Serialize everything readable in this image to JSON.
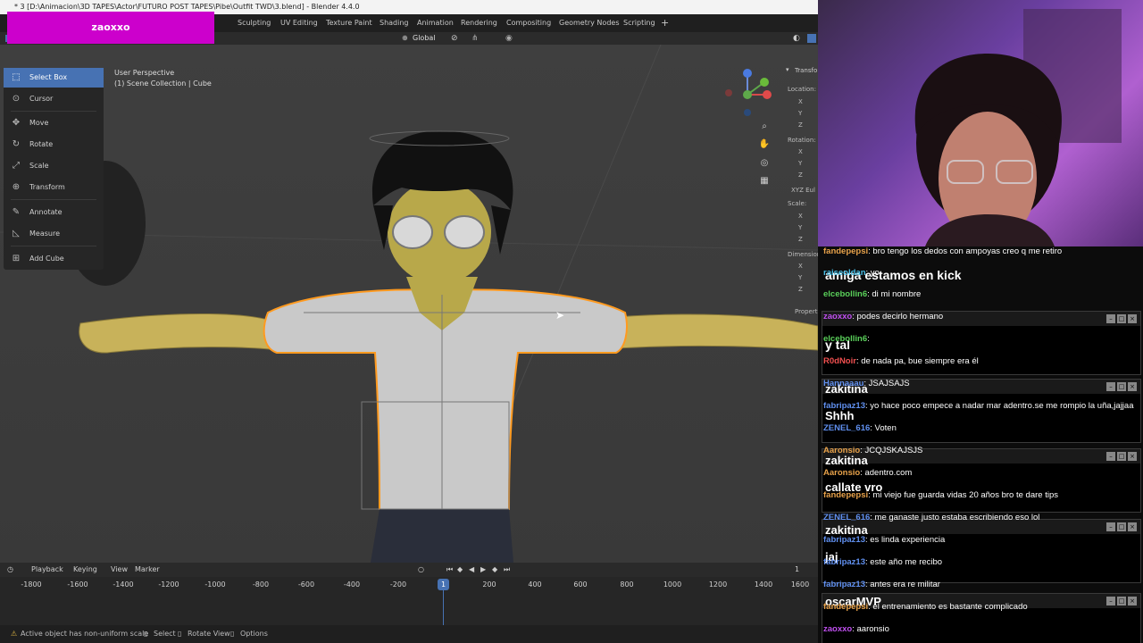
{
  "window_title": "* 3 [D:\\Animacion\\3D TAPES\\Actor\\FUTURO POST TAPES\\Pibe\\Outfit TWD\\3.blend] - Blender 4.4.0",
  "workspace_tabs": [
    "Sculpting",
    "UV Editing",
    "Texture Paint",
    "Shading",
    "Animation",
    "Rendering",
    "Compositing",
    "Geometry Nodes",
    "Scripting"
  ],
  "add_workspace": "+",
  "header": {
    "orientation": "Global"
  },
  "overlay_name": "zaoxxo",
  "viewport": {
    "view_name": "User Perspective",
    "collection": "(1) Scene Collection | Cube"
  },
  "toolbar": {
    "tools": [
      {
        "label": "Select Box",
        "icon": "select-box-icon",
        "active": true
      },
      {
        "label": "Cursor",
        "icon": "cursor-icon"
      },
      {
        "label": "Move",
        "icon": "move-icon"
      },
      {
        "label": "Rotate",
        "icon": "rotate-icon"
      },
      {
        "label": "Scale",
        "icon": "scale-icon"
      },
      {
        "label": "Transform",
        "icon": "transform-icon"
      },
      {
        "label": "Annotate",
        "icon": "annotate-icon"
      },
      {
        "label": "Measure",
        "icon": "measure-icon"
      },
      {
        "label": "Add Cube",
        "icon": "add-cube-icon"
      }
    ]
  },
  "npanel": {
    "transform": "Transfo",
    "location": "Location:",
    "rotation": "Rotation:",
    "rotation_mode": "XYZ Eul",
    "scale": "Scale:",
    "dimensions": "Dimension",
    "properties": "Properti",
    "axes": [
      "X",
      "Y",
      "Z"
    ]
  },
  "timeline": {
    "menus": [
      "Playback",
      "Keying",
      "View",
      "Marker"
    ],
    "current_frame": "1",
    "playhead_label": "1",
    "ticks": [
      "-1800",
      "-1600",
      "-1400",
      "-1200",
      "-1000",
      "-800",
      "-600",
      "-400",
      "-200",
      "200",
      "400",
      "600",
      "800",
      "1000",
      "1200",
      "1400",
      "1600"
    ]
  },
  "statusbar": {
    "warning": "Active object has non-uniform scale",
    "select": "Select",
    "rotate_view": "Rotate View",
    "options": "Options"
  },
  "chat": {
    "messages": [
      {
        "user": "fandepepsi",
        "text": ": bro tengo los dedos con ampoyas creo q me retiro",
        "color": "#e8a24a"
      },
      {
        "user": "raiseoldan",
        "text": ": yo",
        "color": "#4ac0e8"
      },
      {
        "user": "elcebollin6",
        "text": ": di mi nombre",
        "color": "#5ad05a"
      },
      {
        "user": "zaoxxo",
        "text": ": podes decirlo hermano",
        "color": "#c050f0"
      },
      {
        "user": "elcebollin6",
        "text": ":",
        "color": "#5ad05a"
      },
      {
        "user": "R0dNoir",
        "text": ": de nada pa, bue siempre era él",
        "color": "#f05050"
      },
      {
        "user": "Hannaaau",
        "text": ": JSAJSAJS",
        "color": "#6090f0"
      },
      {
        "user": "fabripaz13",
        "text": ": yo hace poco empece a nadar mar adentro.se me rompio la uña,jajjaa",
        "color": "#6090f0"
      },
      {
        "user": "ZENEL_616",
        "text": ": Voten",
        "color": "#6090f0"
      },
      {
        "user": "Aaronsio",
        "text": ": JCQJSKAJSJS",
        "color": "#e8a24a"
      },
      {
        "user": "Aaronsio",
        "text": ": adentro.com",
        "color": "#e8a24a"
      },
      {
        "user": "fandepepsi",
        "text": ": mi viejo fue guarda vidas 20 años bro te dare tips",
        "color": "#e8a24a"
      },
      {
        "user": "ZENEL_616",
        "text": ": me ganaste justo estaba escribiendo eso lol",
        "color": "#6090f0"
      },
      {
        "user": "fabripaz13",
        "text": ": es linda experiencia",
        "color": "#6090f0"
      },
      {
        "user": "fabripaz13",
        "text": ": este año me recibo",
        "color": "#6090f0"
      },
      {
        "user": "fabripaz13",
        "text": ": antes era re militar",
        "color": "#6090f0"
      },
      {
        "user": "fandepepsi",
        "text": ": el entrenamiento es bastante complicado",
        "color": "#e8a24a"
      },
      {
        "user": "zaoxxo",
        "text": ": aaronsio",
        "color": "#c050f0"
      }
    ],
    "overlays": [
      "amiga estamos en kick",
      "y tal",
      "zakitina",
      "Shhh",
      "zakitina",
      "callate vro",
      "zakitina",
      "jaj",
      "oscarMVP"
    ]
  },
  "colors": {
    "accent": "#4772b3",
    "nameplate": "#cc00cc",
    "selection_outline": "#ff9a1f"
  }
}
